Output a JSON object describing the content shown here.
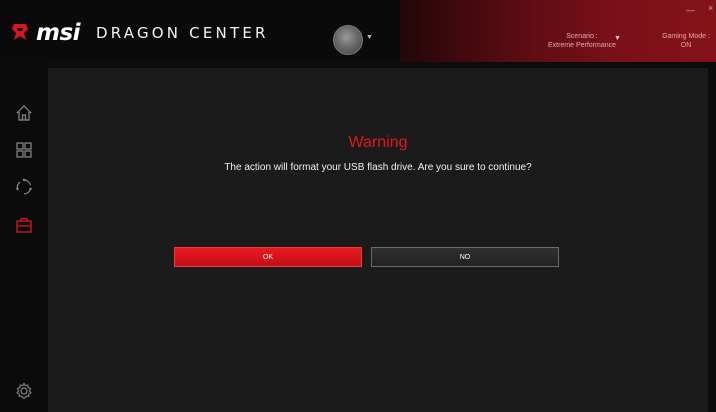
{
  "header": {
    "brand": "msi",
    "product": "DRAGON CENTER",
    "scenario_label": "Scenario :",
    "scenario_value": "Extreme Performance",
    "gaming_label": "Gaming Mode :",
    "gaming_value": "ON",
    "minimize_label": "—",
    "close_label": "×"
  },
  "sidebar": {
    "items": [
      {
        "icon": "home-icon"
      },
      {
        "icon": "grid-icon"
      },
      {
        "icon": "refresh-icon"
      },
      {
        "icon": "toolbox-icon",
        "active": true
      }
    ],
    "settings_icon": "gear-icon"
  },
  "dialog": {
    "title": "Warning",
    "message": "The action will format your USB flash drive. Are you sure to continue?",
    "ok_label": "OK",
    "no_label": "NO"
  },
  "colors": {
    "accent": "#e0161c",
    "panel": "#1b1b1b",
    "background": "#0b0b0b"
  }
}
